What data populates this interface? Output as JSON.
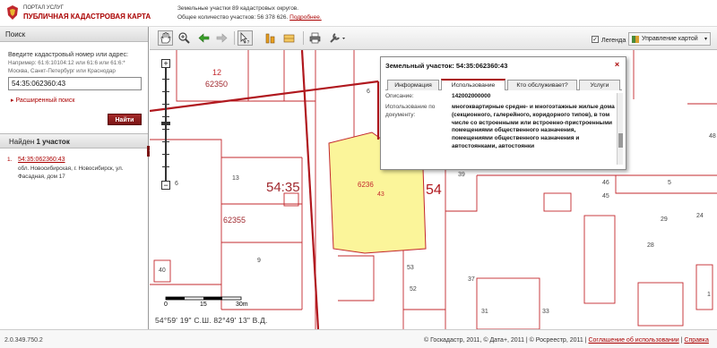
{
  "header": {
    "portal_small": "ПОРТАЛ УСЛУГ",
    "portal_title": "ПУБЛИЧНАЯ КАДАСТРОВАЯ КАРТА",
    "info_line1": "Земельные участки 89 кадастровых округов.",
    "info_line2": "Общее количество участков: 56 378 626.",
    "info_link": "Подробнее."
  },
  "search": {
    "heading": "Поиск",
    "prompt": "Введите кадастровый номер или адрес:",
    "example1": "Например: 61:6:10104:12 или 61:6 или 61:6:*",
    "example2": "Москва, Санкт-Петербург или Краснодар",
    "input_value": "54:35:062360:43",
    "advanced": "Расширенный поиск",
    "button": "Найти"
  },
  "results": {
    "found_prefix": "Найден ",
    "found_bold": "1 участок",
    "items": [
      {
        "num": "1.",
        "id": "54:35:062360:43",
        "addr1": "обл. Новосибирская, г. Новосибирск, ул.",
        "addr2": "Фасадная, дом 17"
      }
    ]
  },
  "toolbar": {
    "legend_label": "Легенда",
    "legend_checked": "✓",
    "map_control": "Управление картой",
    "arrow": "▾"
  },
  "map": {
    "labels": [
      {
        "text": "12"
      },
      {
        "text": "62350"
      },
      {
        "text": "6"
      },
      {
        "text": "13"
      },
      {
        "text": "54:35"
      },
      {
        "text": "54"
      },
      {
        "text": "6236"
      },
      {
        "text": "43"
      },
      {
        "text": "62355"
      },
      {
        "text": "9"
      },
      {
        "text": "6"
      },
      {
        "text": "40"
      },
      {
        "text": "39"
      },
      {
        "text": "37"
      },
      {
        "text": "53"
      },
      {
        "text": "52"
      },
      {
        "text": "46"
      },
      {
        "text": "45"
      },
      {
        "text": "29"
      },
      {
        "text": "28"
      },
      {
        "text": "33"
      },
      {
        "text": "31"
      },
      {
        "text": "5"
      },
      {
        "text": "24"
      },
      {
        "text": "48"
      },
      {
        "text": "1"
      }
    ],
    "scale_0": "0",
    "scale_15": "15",
    "scale_30": "30m",
    "coords": "54°59' 19\"  С.Ш.     82°49' 13\"  В.Д.",
    "colors": {
      "parcel_fill": "#fbf59a",
      "boundary": "#c3282e",
      "road": "#b0181e"
    }
  },
  "popup": {
    "title": "Земельный участок: 54:35:062360:43",
    "close": "×",
    "tabs": [
      "Информация",
      "Использование",
      "Кто обслуживает?",
      "Услуги"
    ],
    "active_tab": 1,
    "rows": [
      {
        "label": "Описание:",
        "value": "142002000000"
      },
      {
        "label": "Использование по документу:",
        "value": "многоквартирные средне- и многоэтажные жилые дома (секционного, галерейного, коридорного типов), в том числе со встроенными или встроенно-пристроенными помещениями общественного назначения, помещениями общественного назначения и автостоянками, автостоянки"
      }
    ]
  },
  "footer": {
    "version": "2.0.349.750.2",
    "copyright": "© Госкадастр, 2011, © Дата+, 2011  | © Росреестр, 2011 |",
    "agreement": "Соглашение об использовании",
    "sep": " | ",
    "help": "Справка"
  }
}
